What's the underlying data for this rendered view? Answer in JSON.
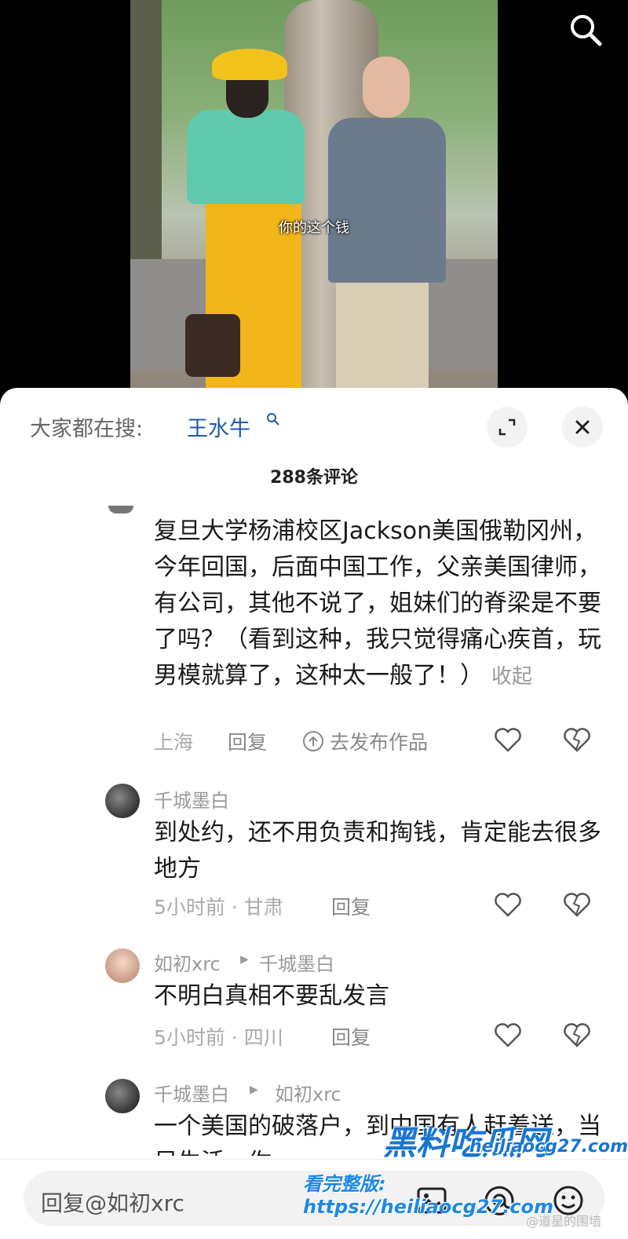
{
  "video": {
    "subtitle": "你的这个钱"
  },
  "sheet": {
    "hot_label": "大家都在搜:",
    "hot_query": "王水牛",
    "comment_count": "288条评论"
  },
  "comments": [
    {
      "id": "c1",
      "text": "复旦大学杨浦校区Jackson美国俄勒冈州，今年回国，后面中国工作，父亲美国律师，有公司，其他不说了，姐妹们的脊梁是不要了吗？（看到这种，我只觉得痛心疾首，玩男模就算了，这种太一般了！）",
      "collapse_label": "收起",
      "location": "上海",
      "reply_label": "回复",
      "publish_label": "去发布作品"
    },
    {
      "id": "c2",
      "user": "千城墨白",
      "text": "到处约，还不用负责和掏钱，肯定能去很多地方",
      "meta": "5小时前 · 甘肃",
      "reply_label": "回复"
    },
    {
      "id": "c3",
      "user": "如初xrc",
      "reply_to": "千城墨白",
      "text": "不明白真相不要乱发言",
      "meta": "5小时前 · 四川",
      "reply_label": "回复"
    },
    {
      "id": "c4",
      "user": "千城墨白",
      "reply_to": "如初xrc",
      "text": "一个美国的破落户，到中国有人赶着送，当足生活，你..."
    }
  ],
  "reply_bar": {
    "placeholder": "回复@如初xrc"
  },
  "watermark": {
    "logo": "黑料吃瓜网",
    "site": "heiliaocg27.com",
    "line": "看完整版: https://heiliaocg27.com",
    "corner": "@道星的围墙"
  },
  "colors": {
    "link_blue": "#1f5aa8",
    "muted_gray": "#999999"
  }
}
